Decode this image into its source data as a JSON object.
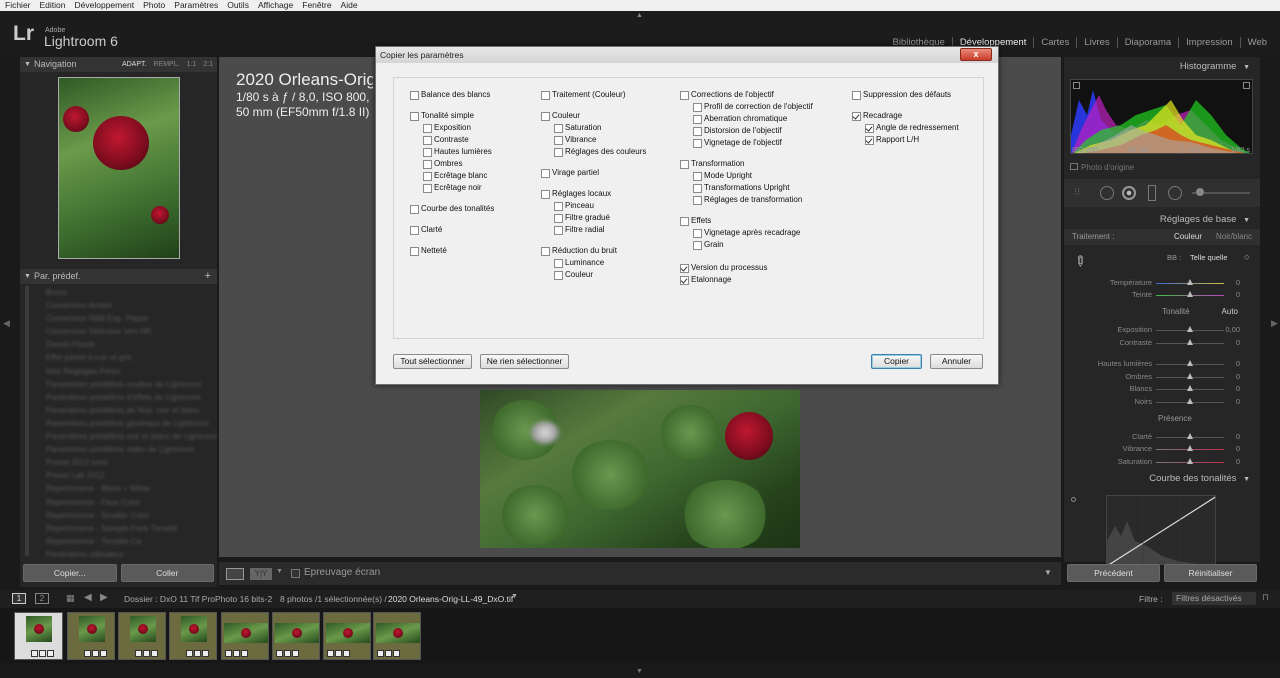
{
  "menubar": [
    "Fichier",
    "Edition",
    "Développement",
    "Photo",
    "Paramètres",
    "Outils",
    "Affichage",
    "Fenêtre",
    "Aide"
  ],
  "identity": {
    "adobe": "Adobe",
    "product": "Lightroom 6",
    "logo": "Lr"
  },
  "modules": [
    {
      "label": "Bibliothèque",
      "active": false
    },
    {
      "label": "Développement",
      "active": true
    },
    {
      "label": "Cartes",
      "active": false
    },
    {
      "label": "Livres",
      "active": false
    },
    {
      "label": "Diaporama",
      "active": false
    },
    {
      "label": "Impression",
      "active": false
    },
    {
      "label": "Web",
      "active": false
    }
  ],
  "left": {
    "navigator": {
      "title": "Navigation",
      "options": [
        "ADAPT.",
        "REMPL.",
        "1:1",
        "2:1"
      ]
    },
    "presets": {
      "title": "Par. prédef.",
      "add": "+"
    },
    "preset_items": [
      "Bruno",
      "Conversion Ambre",
      "Conversion N&B Exp. Papier",
      "Conversion Sélective Vert HR",
      "Dessin Flouté",
      "Effet pastel à cuir et gris",
      "Mes Réglages Perso",
      "Paramètres prédéfinis couleur de Lightroom",
      "Paramètres prédéfinis d'effets de Lightroom",
      "Paramètres prédéfinis de Noir, noir et blanc",
      "Paramètres prédéfinis généraux de Lightroom",
      "Paramètres prédéfinis noir et blanc de Lightroom",
      "Paramètres prédéfinis vidéo de Lightroom",
      "Preset 2012 exist",
      "Preset Lab 2012",
      "Repertorisme - Black + White",
      "Repertorisme - Faux Color",
      "Repertorisme - Smaller Color",
      "Repertorisme - Sample Pack Tonalité",
      "Repertorisme - Tonalité Ca",
      "Paramètres utilisateur"
    ],
    "buttons": {
      "copy": "Copier...",
      "paste": "Coller"
    }
  },
  "center": {
    "info_title": "2020 Orleans-Orig-LL-49_DxO",
    "info_line1": "1/80 s à ƒ / 8,0, ISO 800,",
    "info_line2": "50 mm (EF50mm f/1.8 II)",
    "softproof": "Epreuvage écran"
  },
  "dialog": {
    "title": "Copier les paramètres",
    "close": "x",
    "items": [
      {
        "label": "Balance des blancs",
        "checked": false
      },
      {
        "label": "Tonalité simple",
        "checked": false
      },
      {
        "label": "Exposition",
        "checked": false
      },
      {
        "label": "Contraste",
        "checked": false
      },
      {
        "label": "Hautes lumières",
        "checked": false
      },
      {
        "label": "Ombres",
        "checked": false
      },
      {
        "label": "Ecrêtage blanc",
        "checked": false
      },
      {
        "label": "Ecrêtage noir",
        "checked": false
      },
      {
        "label": "Courbe des tonalités",
        "checked": false
      },
      {
        "label": "Clarté",
        "checked": false
      },
      {
        "label": "Netteté",
        "checked": false
      },
      {
        "label": "Traitement (Couleur)",
        "checked": false
      },
      {
        "label": "Couleur",
        "checked": false
      },
      {
        "label": "Saturation",
        "checked": false
      },
      {
        "label": "Vibrance",
        "checked": false
      },
      {
        "label": "Réglages des couleurs",
        "checked": false
      },
      {
        "label": "Virage partiel",
        "checked": false
      },
      {
        "label": "Réglages locaux",
        "checked": false
      },
      {
        "label": "Pinceau",
        "checked": false
      },
      {
        "label": "Filtre gradué",
        "checked": false
      },
      {
        "label": "Filtre radial",
        "checked": false
      },
      {
        "label": "Réduction du bruit",
        "checked": false
      },
      {
        "label": "Luminance",
        "checked": false
      },
      {
        "label": "Couleur",
        "checked": false
      },
      {
        "label": "Corrections de l'objectif",
        "checked": false
      },
      {
        "label": "Profil de correction de l'objectif",
        "checked": false
      },
      {
        "label": "Aberration chromatique",
        "checked": false
      },
      {
        "label": "Distorsion de l'objectif",
        "checked": false
      },
      {
        "label": "Vignetage de l'objectif",
        "checked": false
      },
      {
        "label": "Transformation",
        "checked": false
      },
      {
        "label": "Mode Upright",
        "checked": false
      },
      {
        "label": "Transformations Upright",
        "checked": false
      },
      {
        "label": "Réglages de transformation",
        "checked": false
      },
      {
        "label": "Effets",
        "checked": false
      },
      {
        "label": "Vignetage après recadrage",
        "checked": false
      },
      {
        "label": "Grain",
        "checked": false
      },
      {
        "label": "Version du processus",
        "checked": true
      },
      {
        "label": "Etalonnage",
        "checked": true
      },
      {
        "label": "Suppression des défauts",
        "checked": false
      },
      {
        "label": "Recadrage",
        "checked": true
      },
      {
        "label": "Angle de redressement",
        "checked": true
      },
      {
        "label": "Rapport L/H",
        "checked": true
      }
    ],
    "buttons": {
      "select_all": "Tout sélectionner",
      "select_none": "Ne rien sélectionner",
      "copy": "Copier",
      "cancel": "Annuler"
    }
  },
  "right": {
    "histogram": {
      "title": "Histogramme",
      "iso": "ISO 800",
      "focal": "50 mm",
      "aperture": "ƒ / 8,0",
      "shutter": "1/80 s",
      "original": "Photo d'origine"
    },
    "basic": {
      "title": "Réglages de base",
      "treatment_label": "Traitement :",
      "treatment_color": "Couleur",
      "treatment_bw": "Noir/blanc",
      "wb_label": "BB :",
      "wb_value": "Telle quelle",
      "tone_label": "Tonalité",
      "auto": "Auto",
      "presence_label": "Présence",
      "sliders": [
        {
          "label": "Température",
          "value": "0",
          "pos": 0.5
        },
        {
          "label": "Teinte",
          "value": "0",
          "pos": 0.5
        },
        {
          "label": "Exposition",
          "value": "0,00",
          "pos": 0.5
        },
        {
          "label": "Contraste",
          "value": "0",
          "pos": 0.5
        },
        {
          "label": "Hautes lumières",
          "value": "0",
          "pos": 0.5
        },
        {
          "label": "Ombres",
          "value": "0",
          "pos": 0.5
        },
        {
          "label": "Blancs",
          "value": "0",
          "pos": 0.5
        },
        {
          "label": "Noirs",
          "value": "0",
          "pos": 0.5
        },
        {
          "label": "Clarté",
          "value": "0",
          "pos": 0.5
        },
        {
          "label": "Vibrance",
          "value": "0",
          "pos": 0.5
        },
        {
          "label": "Saturation",
          "value": "0",
          "pos": 0.5
        }
      ]
    },
    "curve": {
      "title": "Courbe des tonalités"
    },
    "buttons": {
      "previous": "Précédent",
      "reset": "Réinitialiser"
    }
  },
  "filmstrip": {
    "page1": "1",
    "page2": "2",
    "folder": "Dossier : DxO 11 Tif ProPhoto 16 bits-2",
    "count": "8 photos /1 sélectionnée(s) /",
    "filename": "2020 Orleans-Orig-LL-49_DxO.tif",
    "filter_label": "Filtre :",
    "filter_value": "Filtres désactivés"
  }
}
